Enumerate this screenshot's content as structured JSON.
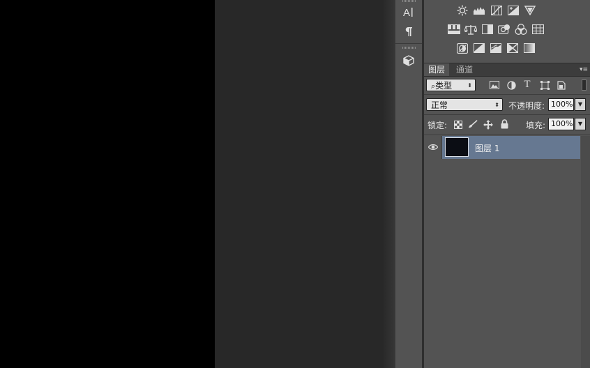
{
  "layers_panel": {
    "tabs": [
      "图层",
      "通道"
    ],
    "filter": {
      "icon": "search-icon",
      "value": "类型"
    },
    "filter_icons": [
      "image-filter-icon",
      "adjustment-filter-icon",
      "type-filter-icon",
      "shape-filter-icon",
      "smart-object-filter-icon",
      "filter-toggle-icon"
    ],
    "blend_mode": "正常",
    "opacity_label": "不透明度:",
    "opacity_value": "100%",
    "lock_label": "锁定:",
    "lock_icons": [
      "lock-transparent-icon",
      "lock-image-icon",
      "lock-position-icon",
      "lock-all-icon"
    ],
    "fill_label": "填充:",
    "fill_value": "100%",
    "layers": [
      {
        "name": "图层 1",
        "visible": true,
        "selected": true
      }
    ]
  },
  "dock": {
    "items": [
      "character-icon",
      "paragraph-icon",
      "3d-icon"
    ]
  },
  "adjustments_panel": {
    "rows": [
      [
        "brightness-icon",
        "levels-icon",
        "curves-icon",
        "exposure-icon",
        "vibrance-icon"
      ],
      [
        "hue-saturation-icon",
        "color-balance-icon",
        "black-white-icon",
        "photo-filter-icon",
        "channel-mixer-icon",
        "color-lookup-icon"
      ],
      [
        "invert-icon",
        "posterize-icon",
        "threshold-icon",
        "gradient-map-icon",
        "selective-color-icon"
      ]
    ]
  },
  "colors": {
    "panel_bg": "#535353",
    "selected_layer": "#667891",
    "canvas_document": "#000000",
    "workspace_bg": "#282828"
  }
}
